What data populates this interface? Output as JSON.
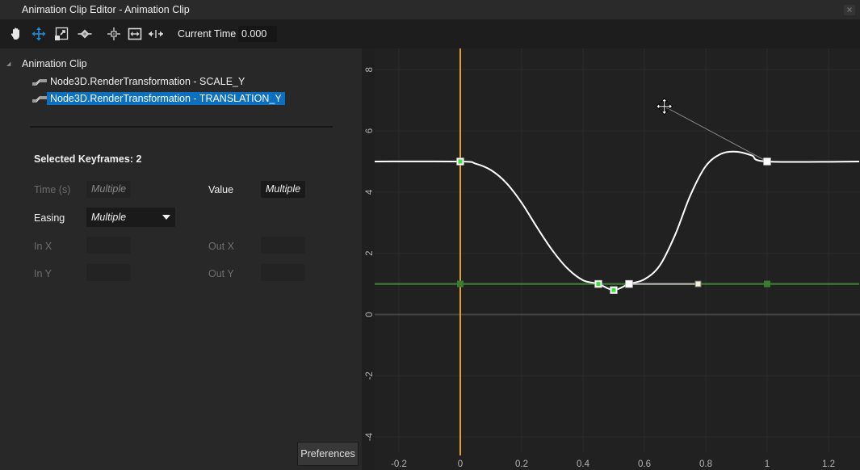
{
  "window": {
    "title": "Animation Clip Editor - Animation Clip",
    "close_icon": "close-icon"
  },
  "toolbar": {
    "tools": [
      {
        "name": "pan-tool",
        "icon": "hand-icon",
        "active": false
      },
      {
        "name": "move-tool",
        "icon": "move-arrows-icon",
        "active": true
      },
      {
        "name": "scale-tool",
        "icon": "scale-icon",
        "active": false
      },
      {
        "name": "keyframe-tool",
        "icon": "diamond-keyframe-icon",
        "active": false
      },
      {
        "name": "frame-selection",
        "icon": "crosshair-icon",
        "active": false
      },
      {
        "name": "fit-horizontal",
        "icon": "fit-width-icon",
        "active": false
      },
      {
        "name": "expand-horizontal",
        "icon": "expand-horizontal-icon",
        "active": false
      }
    ],
    "current_time_label": "Current Time",
    "current_time_value": "0.000",
    "active_color": "#1e8ad6"
  },
  "tree": {
    "root_label": "Animation Clip",
    "tracks": [
      {
        "label": "Node3D.RenderTransformation - SCALE_Y",
        "selected": false
      },
      {
        "label": "Node3D.RenderTransformation - TRANSLATION_Y",
        "selected": true
      }
    ],
    "selection_color": "#0c6fbf"
  },
  "properties": {
    "selected_keyframes": "Selected Keyframes: 2",
    "time_label": "Time (s)",
    "time_value": "Multiple",
    "value_label": "Value",
    "value_value": "Multiple",
    "easing_label": "Easing",
    "easing_value": "Multiple",
    "in_x_label": "In X",
    "in_x_value": "",
    "out_x_label": "Out X",
    "out_x_value": "",
    "in_y_label": "In Y",
    "in_y_value": "",
    "out_y_label": "Out Y",
    "out_y_value": ""
  },
  "preferences_label": "Preferences",
  "chart_data": {
    "type": "line",
    "title": "",
    "xlabel": "",
    "ylabel": "",
    "xlim": [
      -0.25,
      1.3
    ],
    "ylim": [
      -4.5,
      8.4
    ],
    "x_ticks": [
      -0.2,
      0,
      0.2,
      0.4,
      0.6,
      0.8,
      1,
      1.2
    ],
    "x_tick_labels": [
      "-0.2",
      "0",
      "0.2",
      "0.4",
      "0.6",
      "0.8",
      "1",
      "1.2"
    ],
    "y_ticks": [
      -4,
      -2,
      0,
      2,
      4,
      6,
      8
    ],
    "y_tick_labels": [
      "-4",
      "-2",
      "0",
      "2",
      "4",
      "6",
      "8"
    ],
    "grid": true,
    "current_time": 0,
    "current_time_color": "#e0a020",
    "series": [
      {
        "name": "TRANSLATION_Y",
        "color": "#ffffff",
        "keyframes": [
          {
            "x": 0,
            "y": 5,
            "selected": true
          },
          {
            "x": 0.45,
            "y": 1,
            "selected": true
          },
          {
            "x": 0.5,
            "y": 0.8,
            "selected": true
          },
          {
            "x": 0.55,
            "y": 1,
            "selected": false
          },
          {
            "x": 1,
            "y": 5,
            "selected": false
          }
        ],
        "curve": [
          [
            -0.28,
            5
          ],
          [
            0,
            5
          ],
          [
            0.05,
            4.93
          ],
          [
            0.1,
            4.72
          ],
          [
            0.15,
            4.3
          ],
          [
            0.2,
            3.65
          ],
          [
            0.25,
            2.85
          ],
          [
            0.3,
            2.1
          ],
          [
            0.35,
            1.5
          ],
          [
            0.4,
            1.12
          ],
          [
            0.45,
            1
          ],
          [
            0.5,
            0.8
          ],
          [
            0.55,
            1
          ],
          [
            0.6,
            1.15
          ],
          [
            0.65,
            1.6
          ],
          [
            0.7,
            2.6
          ],
          [
            0.75,
            3.9
          ],
          [
            0.8,
            4.85
          ],
          [
            0.85,
            5.25
          ],
          [
            0.9,
            5.32
          ],
          [
            0.95,
            5.2
          ],
          [
            1,
            5
          ],
          [
            1.3,
            5
          ]
        ],
        "tangent_handles": [
          {
            "from": [
              1,
              5
            ],
            "to": [
              0.665,
              6.8
            ]
          },
          {
            "from": [
              0.55,
              1
            ],
            "to": [
              0.775,
              1
            ]
          }
        ]
      },
      {
        "name": "SCALE_Y",
        "color": "#3d7a34",
        "keyframes": [
          {
            "x": 0,
            "y": 1
          },
          {
            "x": 1,
            "y": 1
          }
        ],
        "curve": [
          [
            -0.28,
            1
          ],
          [
            1.3,
            1
          ]
        ]
      }
    ],
    "cursor": {
      "icon": "move-cursor-icon",
      "x": 0.665,
      "y": 6.8
    }
  }
}
